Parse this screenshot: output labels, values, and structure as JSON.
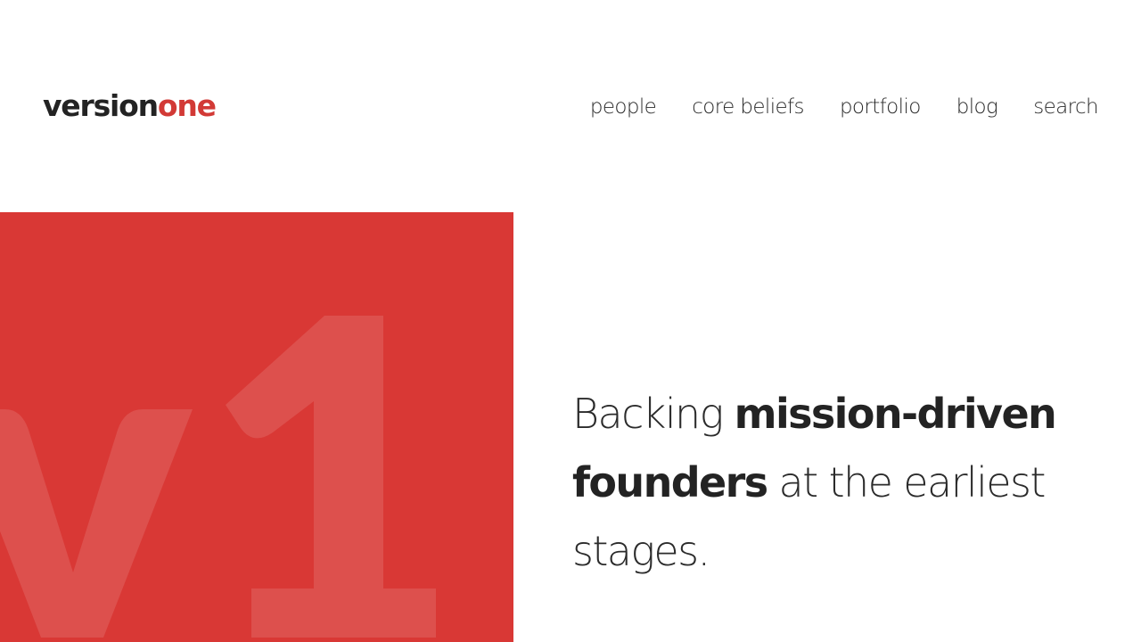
{
  "brand": {
    "name_dark": "version",
    "name_accent": "one",
    "accent_color": "#d23a36"
  },
  "nav": {
    "items": [
      {
        "label": "people"
      },
      {
        "label": "core beliefs"
      },
      {
        "label": "portfolio"
      },
      {
        "label": "blog"
      },
      {
        "label": "search"
      }
    ]
  },
  "hero": {
    "block_color": "#d93835",
    "graphic_text": "v1",
    "tagline": {
      "part1": "Backing ",
      "part2_bold": "mission-driven founders",
      "part3": " at the earliest stages."
    }
  }
}
